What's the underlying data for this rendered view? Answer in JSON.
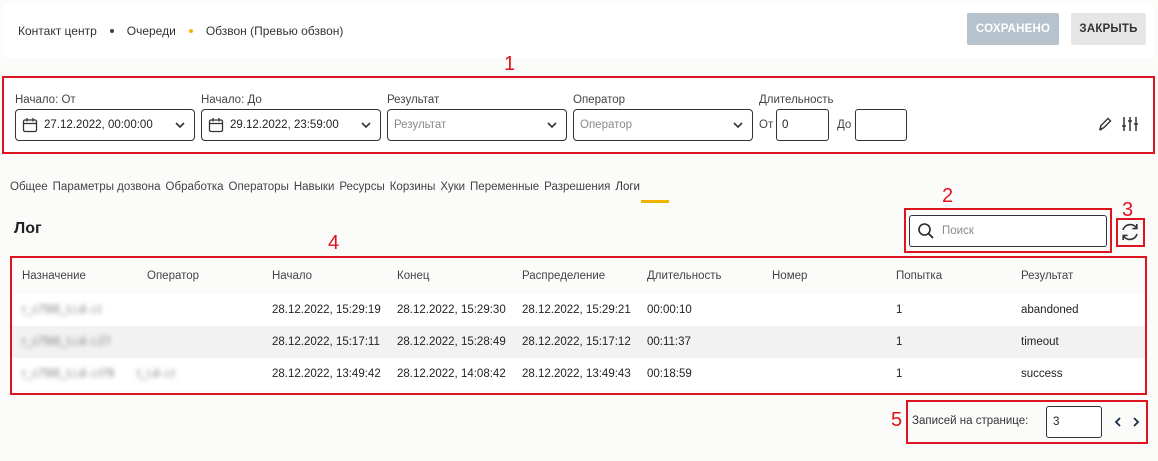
{
  "breadcrumb": {
    "items": [
      "Контакт центр",
      "Очереди",
      "Обзвон (Превью обзвон)"
    ],
    "dot_colors": [
      "#2f3e55",
      "#f0b400"
    ]
  },
  "header": {
    "saved_label": "СОХРАНЕНО",
    "close_label": "ЗАКРЫТЬ"
  },
  "filters": {
    "start_from_label": "Начало: От",
    "start_from_value": "27.12.2022, 00:00:00",
    "start_to_label": "Начало: До",
    "start_to_value": "29.12.2022, 23:59:00",
    "result_label": "Результат",
    "result_placeholder": "Результат",
    "operator_label": "Оператор",
    "operator_placeholder": "Оператор",
    "duration_label": "Длительность",
    "duration_from_label": "От",
    "duration_from_value": "0",
    "duration_to_label": "До",
    "duration_to_value": ""
  },
  "tabs": [
    "Общее",
    "Параметры дозвона",
    "Обработка",
    "Операторы",
    "Навыки",
    "Ресурсы",
    "Корзины",
    "Хуки",
    "Переменные",
    "Разрешения",
    "Логи"
  ],
  "active_tab": "Логи",
  "log": {
    "title": "Лог",
    "search_placeholder": "Поиск",
    "columns": [
      "Назначение",
      "Оператор",
      "Начало",
      "Конец",
      "Распределение",
      "Длительность",
      "Номер",
      "Попытка",
      "Результат"
    ],
    "rows": [
      [
        "r_c75t5_t.i.d-.i.t",
        "",
        "28.12.2022, 15:29:19",
        "28.12.2022, 15:29:30",
        "28.12.2022, 15:29:21",
        "00:00:10",
        "",
        "1",
        "abandoned"
      ],
      [
        "r_c75t5_t.i.d-.i.27",
        "",
        "28.12.2022, 15:17:11",
        "28.12.2022, 15:28:49",
        "28.12.2022, 15:17:12",
        "00:11:37",
        "",
        "1",
        "timeout"
      ],
      [
        "r_c75t5_t.i.d-.i.t79",
        "t_i.d-.i.t",
        "28.12.2022, 13:49:42",
        "28.12.2022, 14:08:42",
        "28.12.2022, 13:49:43",
        "00:18:59",
        "",
        "1",
        "success"
      ]
    ]
  },
  "pager": {
    "label": "Записей на странице:",
    "value": "3"
  },
  "annotations": [
    "1",
    "2",
    "3",
    "4",
    "5"
  ],
  "colors": {
    "accent": "#f0b400",
    "annotation": "#e0141e",
    "saved_button": "#b7c3cc"
  }
}
